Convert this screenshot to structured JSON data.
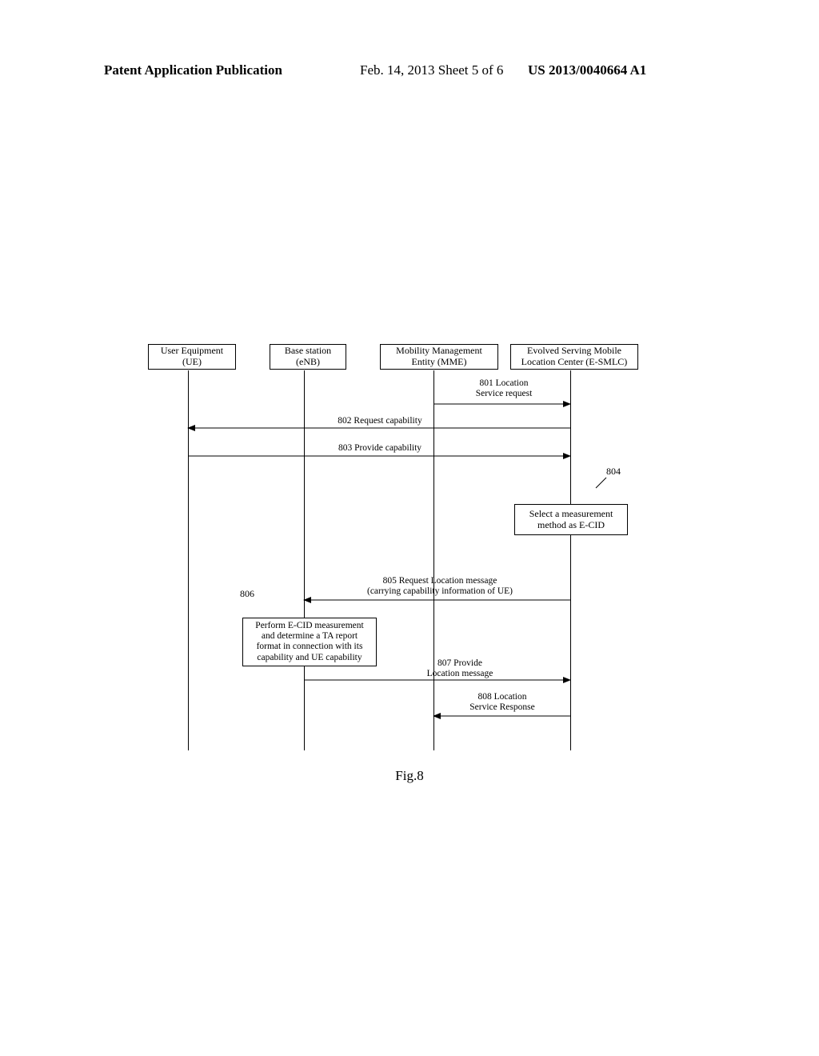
{
  "header": {
    "left": "Patent Application Publication",
    "mid": "Feb. 14, 2013   Sheet 5 of 6",
    "right": "US 2013/0040664 A1"
  },
  "entities": {
    "ue": {
      "line1": "User Equipment",
      "line2": "(UE)"
    },
    "enb": {
      "line1": "Base station",
      "line2": "(eNB)"
    },
    "mme": {
      "line1": "Mobility Management",
      "line2": "Entity (MME)"
    },
    "esmlc": {
      "line1": "Evolved Serving Mobile",
      "line2": "Location Center (E-SMLC)"
    }
  },
  "messages": {
    "m801a": "801 Location",
    "m801b": "Service request",
    "m802": "802 Request capability",
    "m803": "803 Provide capability",
    "m805a": "805  Request Location message",
    "m805b": "(carrying capability information of UE)",
    "m807a": "807 Provide",
    "m807b": "Location message",
    "m808a": "808 Location",
    "m808b": "Service Response"
  },
  "notes": {
    "n804ref": "804",
    "n804a": "Select a measurement",
    "n804b": "method as E-CID",
    "n806ref": "806",
    "n806a": "Perform E-CID measurement",
    "n806b": "and determine a TA report",
    "n806c": "format in connection with its",
    "n806d": "capability and UE capability"
  },
  "figure_caption": "Fig.8"
}
